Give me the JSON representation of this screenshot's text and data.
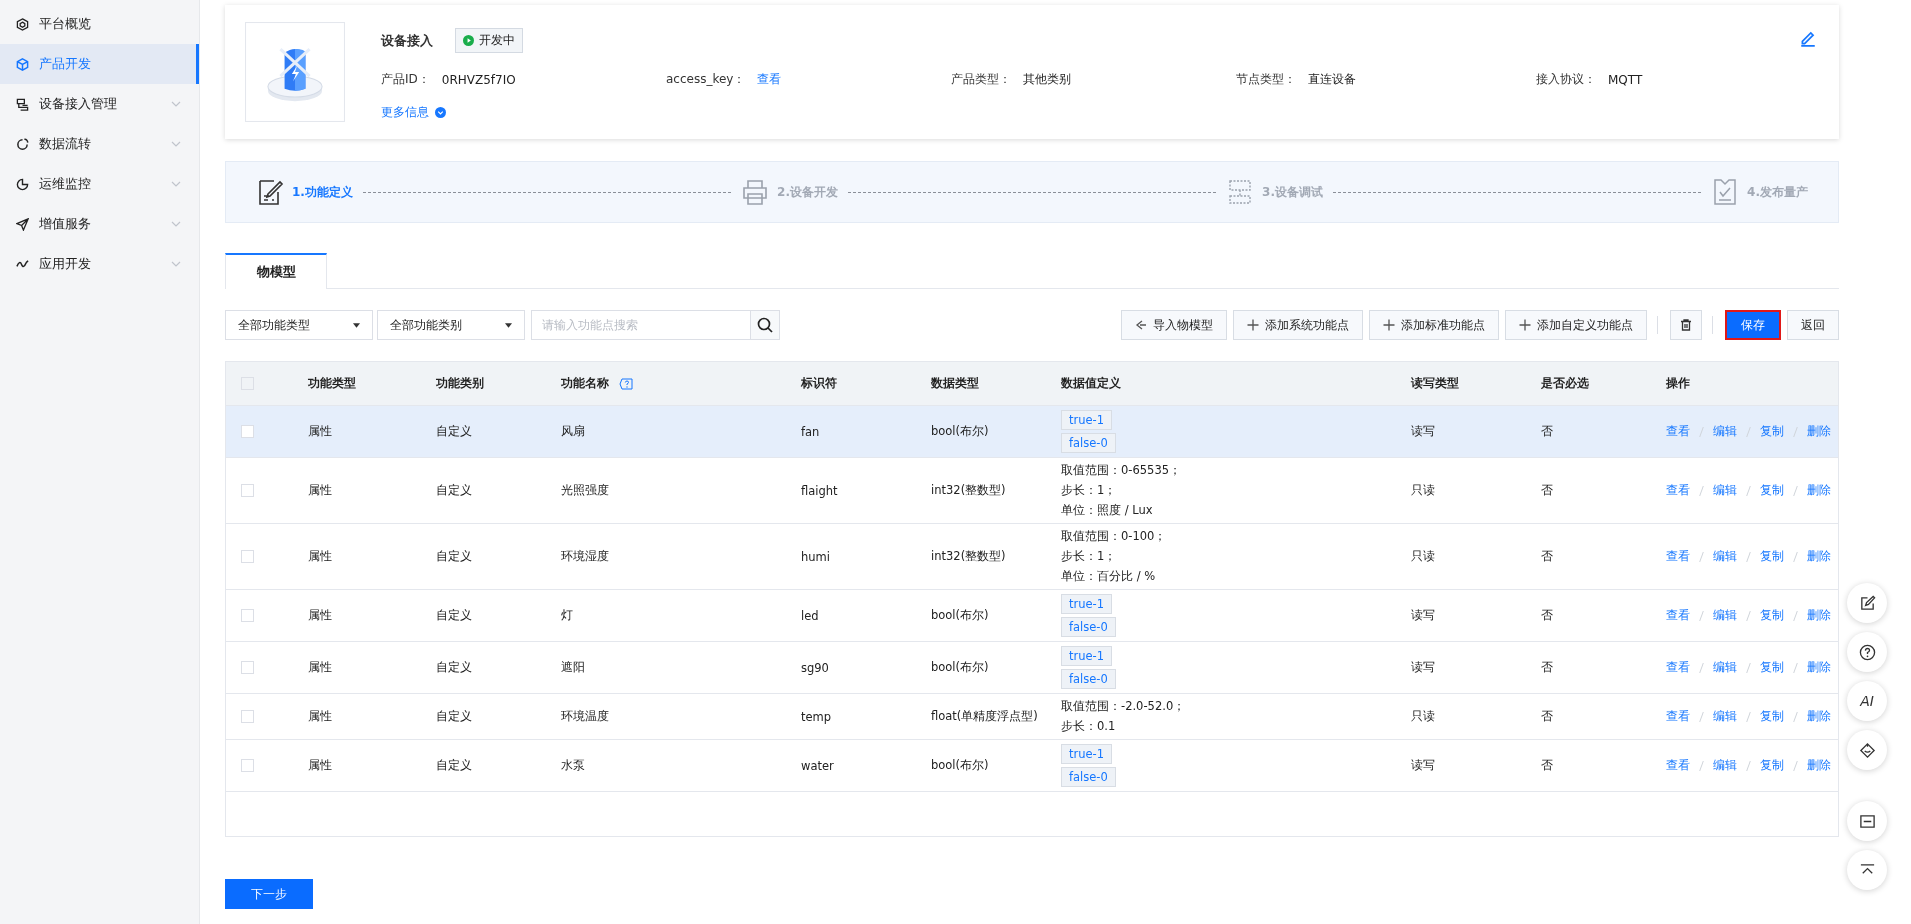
{
  "sidebar": {
    "items": [
      {
        "label": "平台概览",
        "selected": false,
        "expandable": false
      },
      {
        "label": "产品开发",
        "selected": true,
        "expandable": false
      },
      {
        "label": "设备接入管理",
        "selected": false,
        "expandable": true
      },
      {
        "label": "数据流转",
        "selected": false,
        "expandable": true
      },
      {
        "label": "运维监控",
        "selected": false,
        "expandable": true
      },
      {
        "label": "增值服务",
        "selected": false,
        "expandable": true
      },
      {
        "label": "应用开发",
        "selected": false,
        "expandable": true
      }
    ]
  },
  "product": {
    "name": "设备接入",
    "status": "开发中",
    "fields": [
      {
        "label": "产品ID：",
        "value": "0RHVZ5f7IO",
        "kind": "text"
      },
      {
        "label": "access_key：",
        "value": "查看",
        "kind": "link"
      },
      {
        "label": "产品类型：",
        "value": "其他类别",
        "kind": "text"
      },
      {
        "label": "节点类型：",
        "value": "直连设备",
        "kind": "text"
      },
      {
        "label": "接入协议：",
        "value": "MQTT",
        "kind": "text"
      }
    ],
    "more_info": "更多信息"
  },
  "steps": [
    {
      "label": "1.功能定义",
      "selected": true
    },
    {
      "label": "2.设备开发",
      "selected": false
    },
    {
      "label": "3.设备调试",
      "selected": false
    },
    {
      "label": "4.发布量产",
      "selected": false
    }
  ],
  "tabs": [
    {
      "label": "物模型",
      "selected": true
    }
  ],
  "filters": {
    "type_select": "全部功能类型",
    "category_select": "全部功能类别",
    "search": {
      "placeholder": "请输入功能点搜索"
    }
  },
  "toolbar": [
    {
      "label": "导入物模型",
      "kind": "import"
    },
    {
      "label": "添加系统功能点",
      "kind": "add"
    },
    {
      "label": "添加标准功能点",
      "kind": "add"
    },
    {
      "label": "添加自定义功能点",
      "kind": "add"
    }
  ],
  "actions": [
    {
      "label": "保存",
      "kind": "primary"
    },
    {
      "label": "返回",
      "kind": "default"
    }
  ],
  "table": {
    "header_checked": false,
    "columns": [
      "功能类型",
      "功能类别",
      "功能名称",
      "标识符",
      "数据类型",
      "数据值定义",
      "读写类型",
      "是否必选",
      "操作"
    ],
    "rows": [
      {
        "selected": true,
        "checked": false,
        "type": "属性",
        "category": "自定义",
        "name": "风扇",
        "identifier": "fan",
        "data_type": "bool(布尔)",
        "kind": "enum",
        "values": [
          "true-1",
          "false-0"
        ],
        "access": "读写",
        "required": "否",
        "actions": [
          "查看",
          "编辑",
          "复制",
          "删除"
        ]
      },
      {
        "selected": false,
        "checked": false,
        "type": "属性",
        "category": "自定义",
        "name": "光照强度",
        "identifier": "flaight",
        "data_type": "int32(整数型)",
        "kind": "text",
        "values": [
          "取值范围：0-65535；",
          "步长：1；",
          "单位：照度 / Lux"
        ],
        "access": "只读",
        "required": "否",
        "actions": [
          "查看",
          "编辑",
          "复制",
          "删除"
        ]
      },
      {
        "selected": false,
        "checked": false,
        "type": "属性",
        "category": "自定义",
        "name": "环境湿度",
        "identifier": "humi",
        "data_type": "int32(整数型)",
        "kind": "text",
        "values": [
          "取值范围：0-100；",
          "步长：1；",
          "单位：百分比 / %"
        ],
        "access": "只读",
        "required": "否",
        "actions": [
          "查看",
          "编辑",
          "复制",
          "删除"
        ]
      },
      {
        "selected": false,
        "checked": false,
        "type": "属性",
        "category": "自定义",
        "name": "灯",
        "identifier": "led",
        "data_type": "bool(布尔)",
        "kind": "enum",
        "values": [
          "true-1",
          "false-0"
        ],
        "access": "读写",
        "required": "否",
        "actions": [
          "查看",
          "编辑",
          "复制",
          "删除"
        ]
      },
      {
        "selected": false,
        "checked": false,
        "type": "属性",
        "category": "自定义",
        "name": "遮阳",
        "identifier": "sg90",
        "data_type": "bool(布尔)",
        "kind": "enum",
        "values": [
          "true-1",
          "false-0"
        ],
        "access": "读写",
        "required": "否",
        "actions": [
          "查看",
          "编辑",
          "复制",
          "删除"
        ]
      },
      {
        "selected": false,
        "checked": false,
        "type": "属性",
        "category": "自定义",
        "name": "环境温度",
        "identifier": "temp",
        "data_type": "float(单精度浮点型)",
        "kind": "text",
        "values": [
          "取值范围：-2.0-52.0；",
          "步长：0.1"
        ],
        "access": "只读",
        "required": "否",
        "actions": [
          "查看",
          "编辑",
          "复制",
          "删除"
        ]
      },
      {
        "selected": false,
        "checked": false,
        "type": "属性",
        "category": "自定义",
        "name": "水泵",
        "identifier": "water",
        "data_type": "bool(布尔)",
        "kind": "enum",
        "values": [
          "true-1",
          "false-0"
        ],
        "access": "读写",
        "required": "否",
        "actions": [
          "查看",
          "编辑",
          "复制",
          "删除"
        ]
      }
    ]
  },
  "next_button": "下一步",
  "float_buttons": [
    {
      "kind": "edit"
    },
    {
      "kind": "help"
    },
    {
      "kind": "ai",
      "label": "AI"
    },
    {
      "kind": "service"
    },
    {
      "kind": "collapse"
    },
    {
      "kind": "top"
    }
  ]
}
